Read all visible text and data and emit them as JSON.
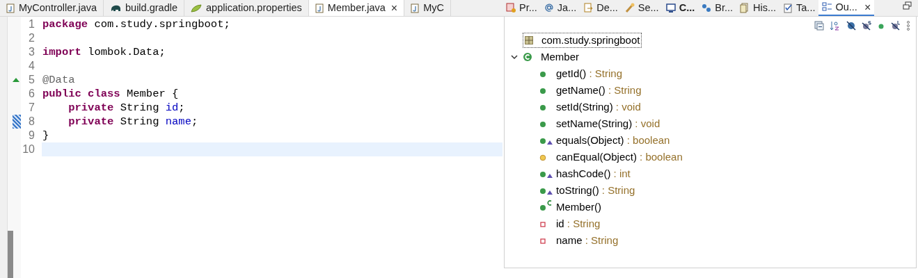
{
  "editor_tabs": [
    {
      "label": "MyController.java",
      "selected": false
    },
    {
      "label": "build.gradle",
      "selected": false
    },
    {
      "label": "application.properties",
      "selected": false
    },
    {
      "label": "Member.java",
      "selected": true,
      "close": "×"
    },
    {
      "label": "MyC",
      "selected": false
    }
  ],
  "code_lines": [
    {
      "number": "1",
      "current": false,
      "overridden": false,
      "changed": false,
      "tokens": [
        {
          "kind": "keyword",
          "text": "package"
        },
        {
          "kind": "plain",
          "text": " com.study.springboot;"
        }
      ]
    },
    {
      "number": "2",
      "current": false,
      "overridden": false,
      "changed": false
    },
    {
      "number": "3",
      "current": false,
      "overridden": false,
      "changed": false,
      "tokens": [
        {
          "kind": "keyword",
          "text": "import"
        },
        {
          "kind": "plain",
          "text": " lombok.Data;"
        }
      ]
    },
    {
      "number": "4",
      "current": false,
      "overridden": false,
      "changed": false
    },
    {
      "number": "5",
      "current": false,
      "overridden": true,
      "changed": false,
      "tokens": [
        {
          "kind": "annotation",
          "text": "@Data"
        }
      ]
    },
    {
      "number": "6",
      "current": false,
      "overridden": false,
      "changed": false,
      "tokens": [
        {
          "kind": "keyword",
          "text": "public"
        },
        {
          "kind": "keyword",
          "text": " class"
        },
        {
          "kind": "plain",
          "text": " Member {"
        }
      ]
    },
    {
      "number": "7",
      "current": false,
      "overridden": false,
      "changed": false,
      "tokens": [
        {
          "kind": "keyword",
          "text": "    private"
        },
        {
          "kind": "plain",
          "text": " String "
        },
        {
          "kind": "field",
          "text": "id"
        },
        {
          "kind": "plain",
          "text": ";"
        }
      ]
    },
    {
      "number": "8",
      "current": false,
      "overridden": false,
      "changed": true,
      "tokens": [
        {
          "kind": "keyword",
          "text": "    private"
        },
        {
          "kind": "plain",
          "text": " String "
        },
        {
          "kind": "field",
          "text": "name"
        },
        {
          "kind": "plain",
          "text": ";"
        }
      ]
    },
    {
      "number": "9",
      "current": false,
      "overridden": false,
      "changed": false,
      "tokens": [
        {
          "kind": "plain",
          "text": "}"
        }
      ]
    },
    {
      "number": "10",
      "current": true,
      "overridden": false,
      "changed": false
    }
  ],
  "view_tabs": [
    {
      "label": "Pr...",
      "selected": false,
      "emphasized": false
    },
    {
      "label": "Ja...",
      "selected": false,
      "emphasized": false
    },
    {
      "label": "De...",
      "selected": false,
      "emphasized": false
    },
    {
      "label": "Se...",
      "selected": false,
      "emphasized": false
    },
    {
      "label": "C...",
      "selected": false,
      "emphasized": true
    },
    {
      "label": "Br...",
      "selected": false,
      "emphasized": false
    },
    {
      "label": "His...",
      "selected": false,
      "emphasized": false
    },
    {
      "label": "Ta...",
      "selected": false,
      "emphasized": false
    },
    {
      "label": "Ou...",
      "selected": true,
      "emphasized": false,
      "close": "×"
    }
  ],
  "outline": {
    "package": {
      "label": "com.study.springboot",
      "selected": false
    },
    "class": {
      "label": "Member",
      "expanded": true,
      "children": [
        {
          "name": "getId()",
          "type": ": String",
          "kind": "public",
          "overrides": false,
          "is_constructor": false
        },
        {
          "name": "getName()",
          "type": ": String",
          "kind": "public",
          "overrides": false,
          "is_constructor": false
        },
        {
          "name": "setId(String)",
          "type": ": void",
          "kind": "public",
          "overrides": false,
          "is_constructor": false
        },
        {
          "name": "setName(String)",
          "type": ": void",
          "kind": "public",
          "overrides": false,
          "is_constructor": false
        },
        {
          "name": "equals(Object)",
          "type": ": boolean",
          "kind": "public",
          "overrides": true,
          "is_constructor": false
        },
        {
          "name": "canEqual(Object)",
          "type": ": boolean",
          "kind": "protected",
          "overrides": false,
          "is_constructor": false
        },
        {
          "name": "hashCode()",
          "type": ": int",
          "kind": "public",
          "overrides": true,
          "is_constructor": false
        },
        {
          "name": "toString()",
          "type": ": String",
          "kind": "public",
          "overrides": true,
          "is_constructor": false
        },
        {
          "name": "Member()",
          "kind": "public",
          "overrides": false,
          "is_constructor": true
        },
        {
          "name": "id",
          "type": ": String",
          "kind": "private",
          "overrides": false,
          "is_constructor": false
        },
        {
          "name": "name",
          "type": ": String",
          "kind": "private",
          "overrides": false,
          "is_constructor": false
        }
      ]
    }
  }
}
